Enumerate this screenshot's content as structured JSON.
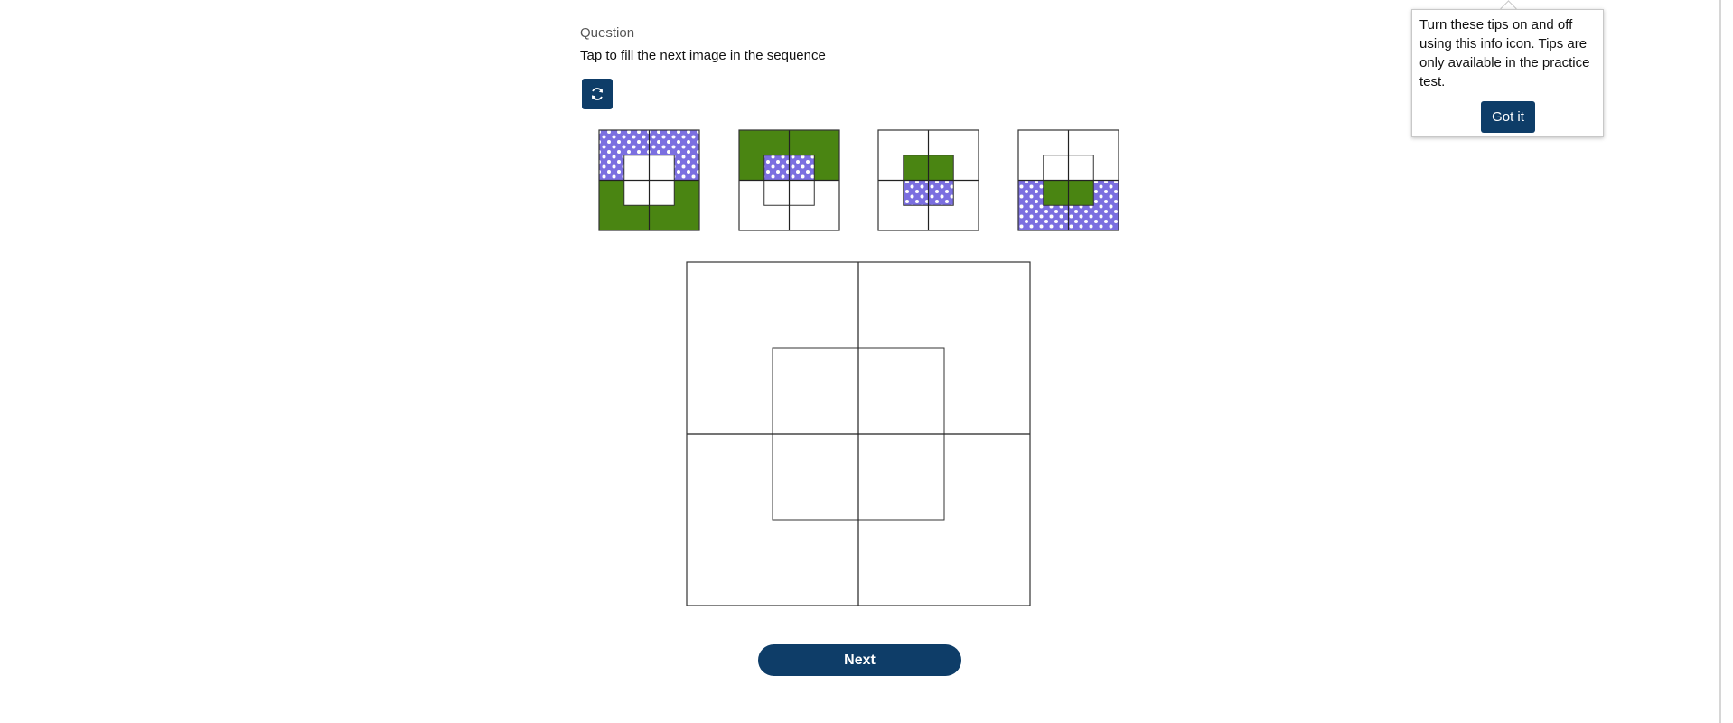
{
  "question": {
    "label": "Question",
    "prompt": "Tap to fill the next image in the sequence"
  },
  "toolbar": {
    "reset_icon": "refresh-icon"
  },
  "colors": {
    "green": "#4a8512",
    "purple_dots": "#7b6fe0",
    "primary": "#0e3d68"
  },
  "sequence": [
    {
      "outer_top": "dots",
      "outer_bottom": "green",
      "inner_top": "white",
      "inner_bottom": "white"
    },
    {
      "outer_top": "green",
      "outer_bottom": "white",
      "inner_top": "dots",
      "inner_bottom": "white"
    },
    {
      "outer_top": "white",
      "outer_bottom": "white",
      "inner_top": "green",
      "inner_bottom": "dots"
    },
    {
      "outer_top": "white",
      "outer_bottom": "dots",
      "inner_top": "white",
      "inner_bottom": "green"
    }
  ],
  "answer": {
    "outer_top": "white",
    "outer_bottom": "white",
    "inner_top": "white",
    "inner_bottom": "white"
  },
  "actions": {
    "next_label": "Next"
  },
  "tip": {
    "text": "Turn these tips on and off using this info icon. Tips are only available in the practice test.",
    "button_label": "Got it"
  }
}
